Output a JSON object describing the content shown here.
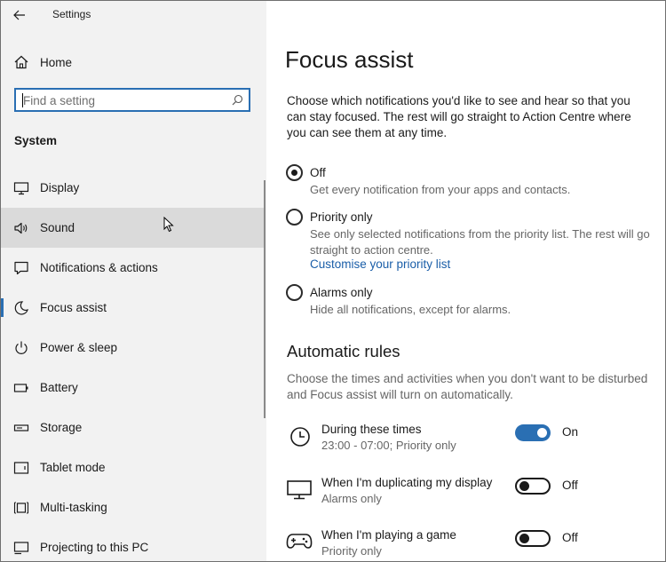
{
  "window": {
    "title": "Settings"
  },
  "sidebar": {
    "home_label": "Home",
    "search": {
      "placeholder": "Find a setting"
    },
    "section_label": "System",
    "items": [
      {
        "label": "Display",
        "icon": "monitor-icon"
      },
      {
        "label": "Sound",
        "icon": "speaker-icon",
        "state": "hover"
      },
      {
        "label": "Notifications & actions",
        "icon": "notification-icon"
      },
      {
        "label": "Focus assist",
        "icon": "moon-icon",
        "state": "selected"
      },
      {
        "label": "Power & sleep",
        "icon": "power-icon"
      },
      {
        "label": "Battery",
        "icon": "battery-icon"
      },
      {
        "label": "Storage",
        "icon": "storage-icon"
      },
      {
        "label": "Tablet mode",
        "icon": "tablet-icon"
      },
      {
        "label": "Multi-tasking",
        "icon": "multitasking-icon"
      },
      {
        "label": "Projecting to this PC",
        "icon": "projector-icon"
      }
    ]
  },
  "main": {
    "title": "Focus assist",
    "intro": "Choose which notifications you'd like to see and hear so that you can stay focused. The rest will go straight to Action Centre where you can see them at any time.",
    "options": [
      {
        "label": "Off",
        "description": "Get every notification from your apps and contacts.",
        "checked": true
      },
      {
        "label": "Priority only",
        "description": "See only selected notifications from the priority list. The rest will go straight to action centre.",
        "link": "Customise your priority list",
        "checked": false
      },
      {
        "label": "Alarms only",
        "description": "Hide all notifications, except for alarms.",
        "checked": false
      }
    ],
    "automatic_rules": {
      "title": "Automatic rules",
      "description": "Choose the times and activities when you don't want to be disturbed and Focus assist will turn on automatically.",
      "rules": [
        {
          "name": "During these times",
          "detail": "23:00 - 07:00; Priority only",
          "toggle": "On",
          "icon": "clock-icon"
        },
        {
          "name": "When I'm duplicating my display",
          "detail": "Alarms only",
          "toggle": "Off",
          "icon": "display-icon"
        },
        {
          "name": "When I'm playing a game",
          "detail": "Priority only",
          "toggle": "Off",
          "icon": "gamepad-icon"
        }
      ]
    }
  },
  "colors": {
    "accent": "#2a6fb3",
    "link": "#1a5ea8",
    "sidebar_bg": "#f2f2f2",
    "hover_bg": "#dadada"
  }
}
